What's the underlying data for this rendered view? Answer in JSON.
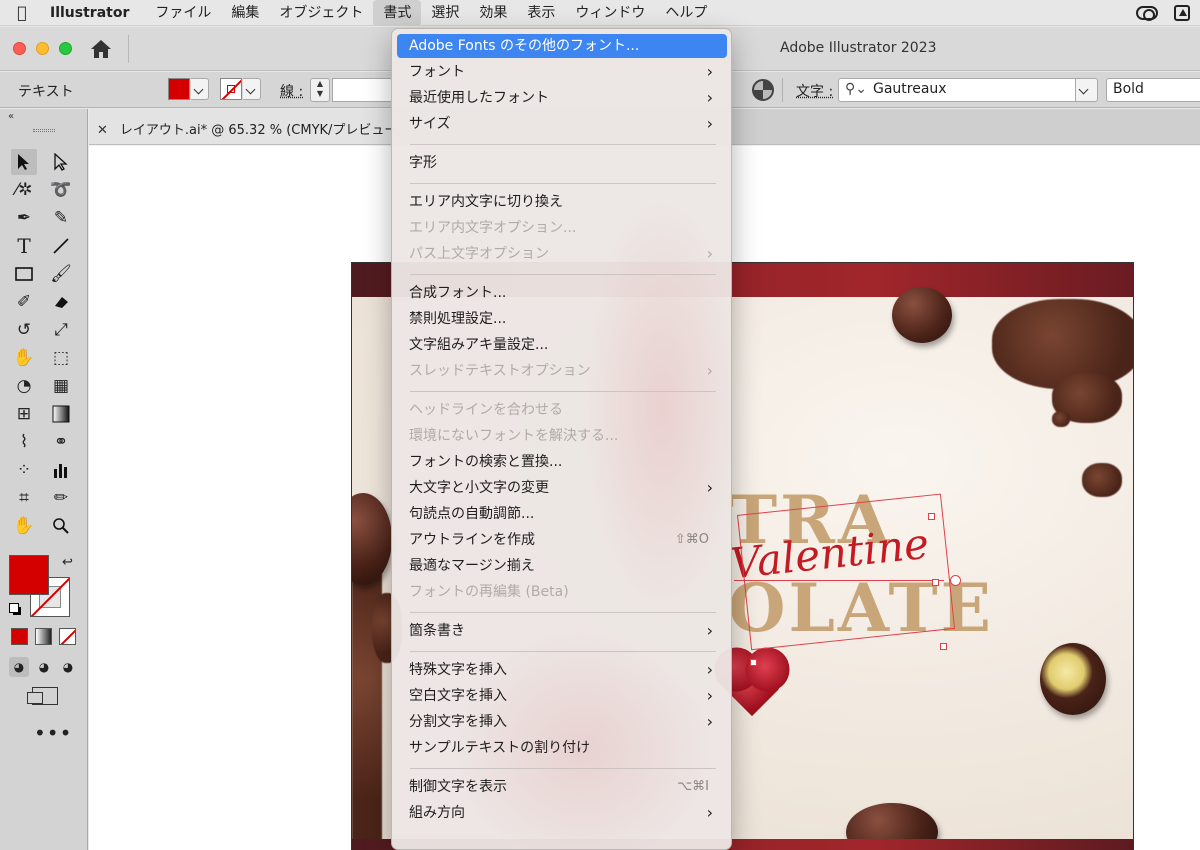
{
  "menubar": {
    "app": "Illustrator",
    "items": [
      "ファイル",
      "編集",
      "オブジェクト",
      "書式",
      "選択",
      "効果",
      "表示",
      "ウィンドウ",
      "ヘルプ"
    ],
    "active_index": 3
  },
  "window": {
    "title": "Adobe Illustrator 2023"
  },
  "control_bar": {
    "mode_label": "テキスト",
    "stroke_label": "線 :",
    "char_label": "文字 :",
    "font_name": "Gautreaux",
    "font_style": "Bold",
    "fill_color": "#d40000",
    "stroke_color": "#d40000"
  },
  "document_tab": {
    "title": "レイアウト.ai* @ 65.32 % (CMYK/プレビュー"
  },
  "tools": {
    "icons": [
      "selection-tool-icon",
      "direct-selection-tool-icon",
      "magic-wand-icon",
      "lasso-icon",
      "pen-icon",
      "curvature-icon",
      "type-tool-icon",
      "line-tool-icon",
      "rectangle-tool-icon",
      "paintbrush-icon",
      "shaper-icon",
      "eraser-icon",
      "rotate-icon",
      "scale-icon",
      "puppet-warp-icon",
      "free-transform-icon",
      "shape-builder-icon",
      "perspective-grid-icon",
      "mesh-icon",
      "gradient-icon",
      "eyedropper-icon",
      "blend-icon",
      "symbol-sprayer-icon",
      "column-graph-icon",
      "artboard-icon",
      "slice-icon",
      "hand-icon",
      "zoom-icon"
    ]
  },
  "artboard": {
    "line1": "TRA",
    "script": "Valentine",
    "line2": "OLATE",
    "accent_color": "#c9a679",
    "script_color": "#c41a22",
    "band_color": "#8d2227"
  },
  "type_menu": {
    "items": [
      {
        "label": "Adobe Fonts のその他のフォント...",
        "highlighted": true
      },
      {
        "label": "フォント",
        "submenu": true
      },
      {
        "label": "最近使用したフォント",
        "submenu": true
      },
      {
        "label": "サイズ",
        "submenu": true
      },
      {
        "separator": true
      },
      {
        "label": "字形"
      },
      {
        "separator": true
      },
      {
        "label": "エリア内文字に切り換え"
      },
      {
        "label": "エリア内文字オプション...",
        "disabled": true
      },
      {
        "label": "パス上文字オプション",
        "submenu": true,
        "disabled": true
      },
      {
        "separator": true
      },
      {
        "label": "合成フォント..."
      },
      {
        "label": "禁則処理設定..."
      },
      {
        "label": "文字組みアキ量設定..."
      },
      {
        "label": "スレッドテキストオプション",
        "submenu": true,
        "disabled": true
      },
      {
        "separator": true
      },
      {
        "label": "ヘッドラインを合わせる",
        "disabled": true
      },
      {
        "label": "環境にないフォントを解決する...",
        "disabled": true
      },
      {
        "label": "フォントの検索と置換..."
      },
      {
        "label": "大文字と小文字の変更",
        "submenu": true
      },
      {
        "label": "句読点の自動調節..."
      },
      {
        "label": "アウトラインを作成",
        "shortcut": "⇧⌘O"
      },
      {
        "label": "最適なマージン揃え"
      },
      {
        "label": "フォントの再編集 (Beta)",
        "disabled": true
      },
      {
        "separator": true
      },
      {
        "label": "箇条書き",
        "submenu": true
      },
      {
        "separator": true
      },
      {
        "label": "特殊文字を挿入",
        "submenu": true
      },
      {
        "label": "空白文字を挿入",
        "submenu": true
      },
      {
        "label": "分割文字を挿入",
        "submenu": true
      },
      {
        "label": "サンプルテキストの割り付け"
      },
      {
        "separator": true
      },
      {
        "label": "制御文字を表示",
        "shortcut": "⌥⌘I"
      },
      {
        "label": "組み方向",
        "submenu": true
      }
    ]
  }
}
